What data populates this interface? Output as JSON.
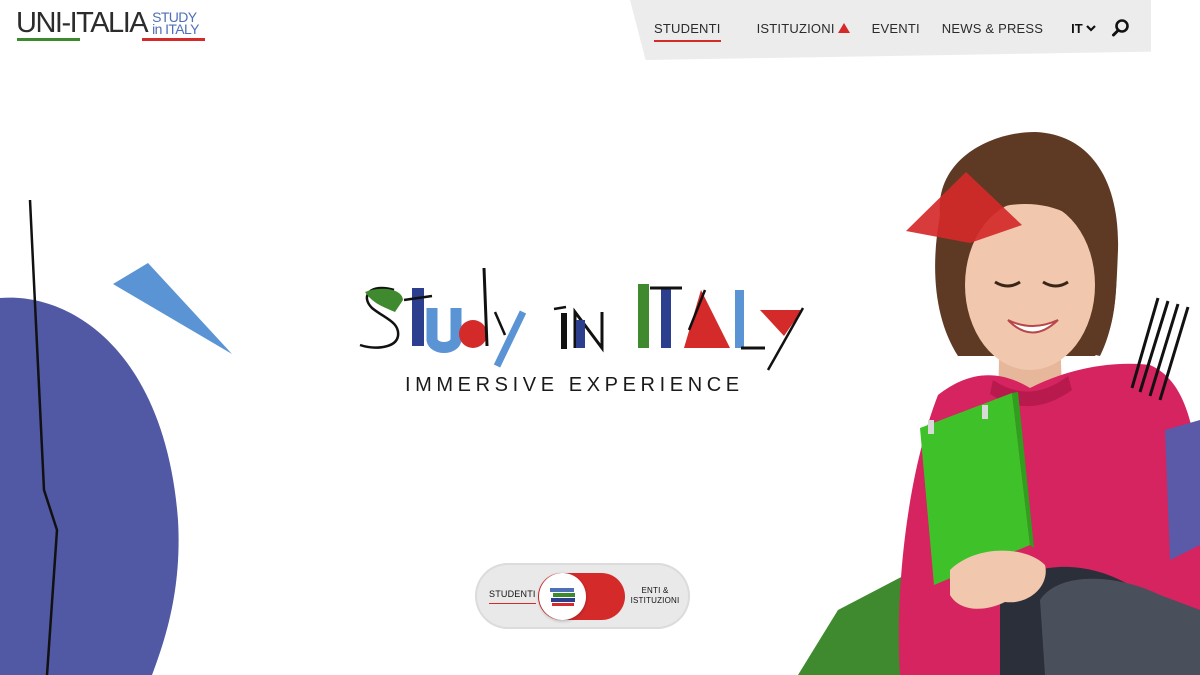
{
  "logo": {
    "main_text": "UNI-ITALIA",
    "sub_line1": "STUDY",
    "sub_line2": "in ITALY"
  },
  "nav": {
    "items": [
      {
        "label": "STUDENTI",
        "active": true
      },
      {
        "label": "ISTITUZIONI",
        "active": false
      },
      {
        "label": "EVENTI",
        "active": false
      },
      {
        "label": "NEWS & PRESS",
        "active": false
      }
    ],
    "language": "IT",
    "icons": [
      "chevron-down-icon",
      "search-icon"
    ]
  },
  "hero": {
    "title": "Study in ITALy",
    "tagline": "IMMERSIVE EXPERIENCE"
  },
  "toggle": {
    "left_label": "STUDENTI",
    "right_label_line1": "ENTI &",
    "right_label_line2": "ISTITUZIONI",
    "selected": "STUDENTI"
  },
  "colors": {
    "brand_red": "#d42a2a",
    "brand_green": "#3b8a2e",
    "brand_blue": "#4f6fb8",
    "indigo": "#5159a4",
    "sky_blue": "#5a94d4",
    "nav_bg": "#ececec"
  }
}
